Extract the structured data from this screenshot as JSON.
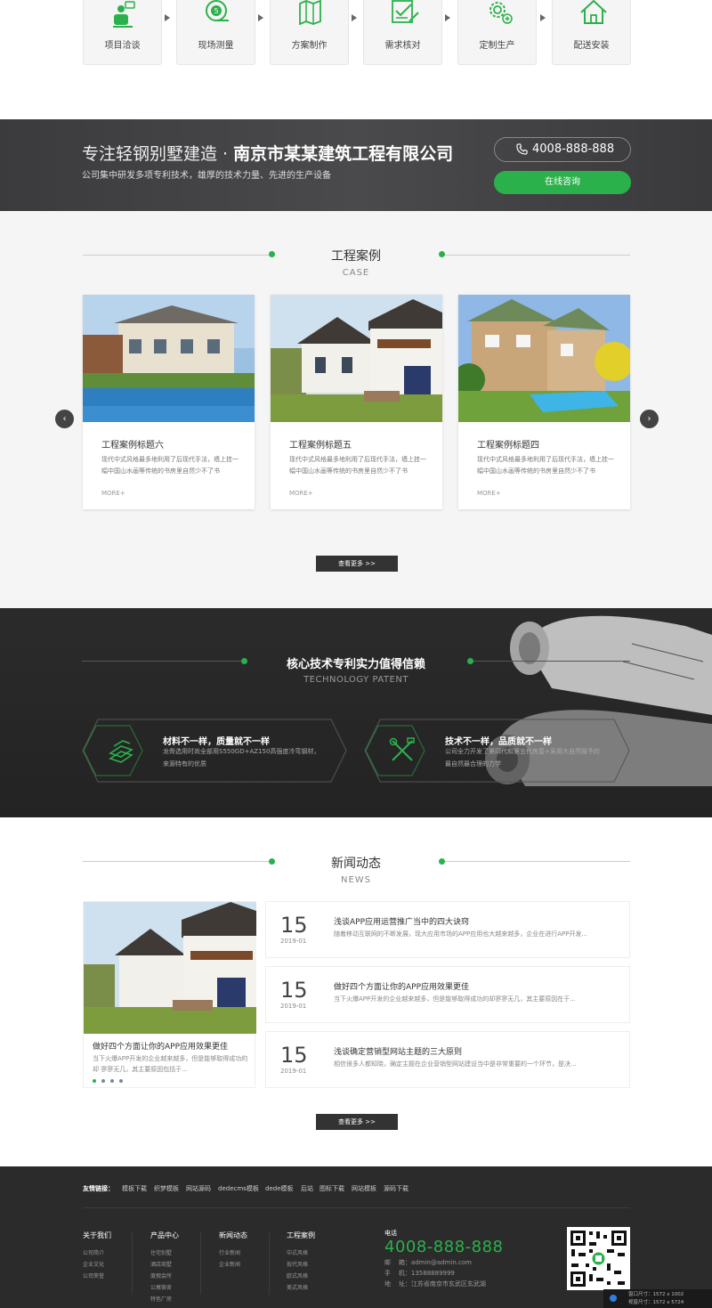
{
  "process": [
    {
      "label": "项目洽谈",
      "icon": "person-chat-icon"
    },
    {
      "label": "现场测量",
      "icon": "tape-measure-icon"
    },
    {
      "label": "方案制作",
      "icon": "map-icon"
    },
    {
      "label": "需求核对",
      "icon": "checklist-icon"
    },
    {
      "label": "定制生产",
      "icon": "gear-add-icon"
    },
    {
      "label": "配送安装",
      "icon": "home-icon"
    }
  ],
  "banner": {
    "title_prefix": "专注轻钢别墅建造 · ",
    "title_company": "南京市某某建筑工程有限公司",
    "subtitle": "公司集中研发多项专利技术，雄厚的技术力量、先进的生产设备",
    "phone": "4008-888-888",
    "consult_label": "在线咨询"
  },
  "cases": {
    "title": "工程案例",
    "subtitle": "CASE",
    "items": [
      {
        "title": "工程案例标题六",
        "desc": "现代中式风格最多地利用了后现代手法，墙上挂一幅中国山水画等传统的书房里自然少不了书",
        "more": "MORE+"
      },
      {
        "title": "工程案例标题五",
        "desc": "现代中式风格最多地利用了后现代手法，墙上挂一幅中国山水画等传统的书房里自然少不了书",
        "more": "MORE+"
      },
      {
        "title": "工程案例标题四",
        "desc": "现代中式风格最多地利用了后现代手法，墙上挂一幅中国山水画等传统的书房里自然少不了书",
        "more": "MORE+"
      }
    ],
    "prev": "‹",
    "next": "›",
    "more_button": "查看更多 >>"
  },
  "tech": {
    "title": "核心技术专利实力值得信赖",
    "subtitle": "TECHNOLOGY PATENT",
    "features": [
      {
        "title": "材料不一样，质量就不一样",
        "desc": "龙骨选用时尚全部用S550GD+AZ150高强度冷弯钢材，来源特有的优质",
        "icon": "steel-bars-icon"
      },
      {
        "title": "技术不一样，品质就不一样",
        "desc": "公司全力开发了第四代和第五代房屋+采用大自然赋予的最自然最合理的力学",
        "icon": "tools-icon"
      }
    ]
  },
  "news": {
    "title": "新闻动态",
    "subtitle": "NEWS",
    "featured": {
      "title": "做好四个方面让你的APP应用效果更佳",
      "desc": "当下火爆APP开发的企业越来越多，但是能够取得成功的却 寥寥无几，其主要原因包括于..."
    },
    "items": [
      {
        "day": "15",
        "ym": "2019-01",
        "title": "浅谈APP应用运营推广当中的四大诀窍",
        "desc": "随着移动互联网的不断发展，现大应用市场的APP应用也大越来越多，企业在进行APP开发..."
      },
      {
        "day": "15",
        "ym": "2019-01",
        "title": "做好四个方面让你的APP应用效果更佳",
        "desc": "当下火爆APP开发的企业越来越多，但是能够取得成功的却寥寥无几，其主要原因在于..."
      },
      {
        "day": "15",
        "ym": "2019-01",
        "title": "浅谈确定营销型网站主题的三大原则",
        "desc": "相信很多人都知晓，确定主题在企业营销型网站建设当中是非常重要的一个环节，是决..."
      }
    ],
    "more_button": "查看更多 >>"
  },
  "footer": {
    "links_label": "友情链接：",
    "links": [
      "模板下载",
      "织梦模板",
      "网站源码",
      "dedecms模板",
      "dede模板",
      "后站",
      "图标下载",
      "网站模板",
      "源码下载"
    ],
    "columns": [
      {
        "title": "关于我们",
        "items": [
          "公司简介",
          "企业文化",
          "公司荣誉"
        ]
      },
      {
        "title": "产品中心",
        "items": [
          "住宅别墅",
          "酒店商墅",
          "度假会所",
          "公寓宿舍",
          "特色厂房"
        ]
      },
      {
        "title": "新闻动态",
        "items": [
          "行业新闻",
          "企业新闻"
        ]
      },
      {
        "title": "工程案例",
        "items": [
          "中式风格",
          "现代风格",
          "欧式风格",
          "美式风格"
        ]
      }
    ],
    "contact": {
      "label": "电话",
      "phone": "4008-888-888",
      "email": "邮    箱：admin@admin.com",
      "mobile": "手    机：13588889999",
      "address": "地    址：江苏省南京市玄武区玄武湖"
    },
    "viewport": "窗口尺寸：1572 x 1002",
    "pagesize": "视窗尺寸：1572 x 5724"
  },
  "colors": {
    "accent": "#2bb14b",
    "dark": "#2b2b2b"
  }
}
